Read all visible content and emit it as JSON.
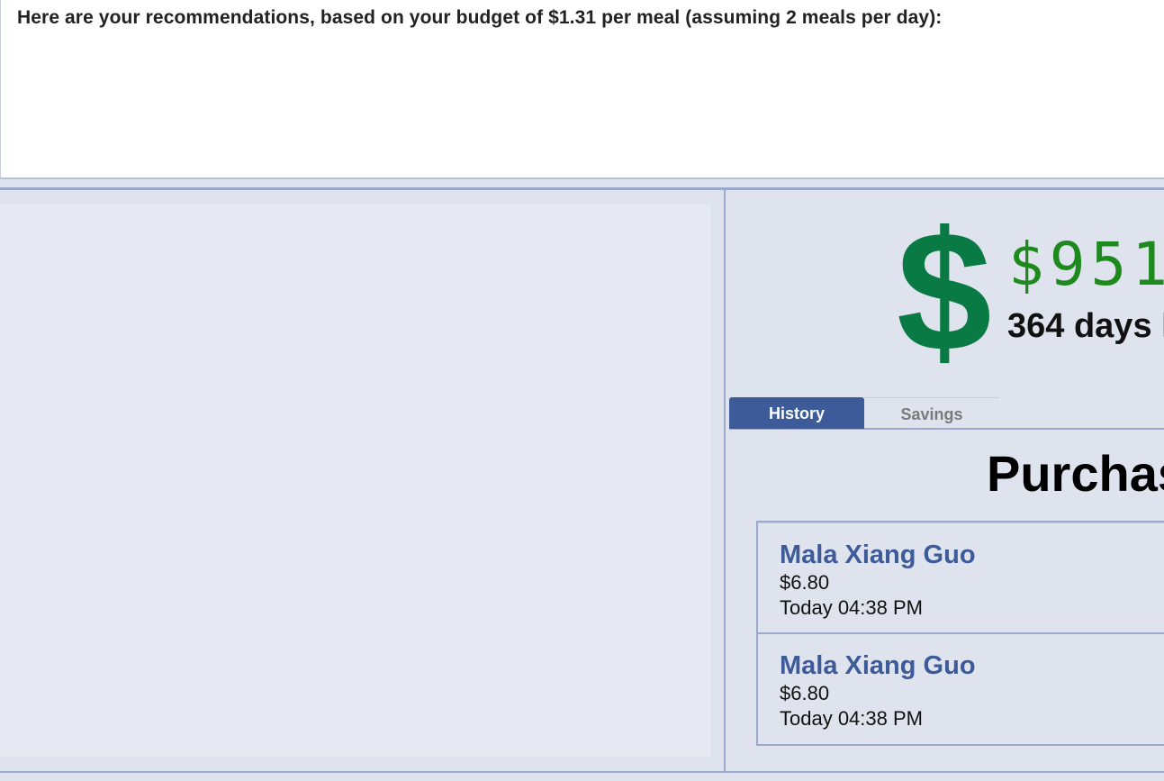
{
  "recommendation": {
    "prefix": "Here are your recommendations, based on your budget of ",
    "amount": "$1.31",
    "middle": " per meal (assuming ",
    "meals": "2",
    "suffix": " meals per day):"
  },
  "savings": {
    "dollar_symbol": "$",
    "amount_visible": "$951",
    "days_visible": "364 days l"
  },
  "tabs": [
    {
      "label": "History",
      "active": true
    },
    {
      "label": "Savings",
      "active": false
    }
  ],
  "purchases": {
    "title_visible": "Purchas",
    "items": [
      {
        "name": "Mala Xiang Guo",
        "price": "$6.80",
        "time": "Today 04:38 PM"
      },
      {
        "name": "Mala Xiang Guo",
        "price": "$6.80",
        "time": "Today 04:38 PM"
      }
    ]
  },
  "colors": {
    "accent": "#3d5a99",
    "money_green": "#0a7a45",
    "amount_green": "#1e8a1e",
    "panel_bg": "#dfe3ed",
    "border": "#9aa9cc"
  }
}
